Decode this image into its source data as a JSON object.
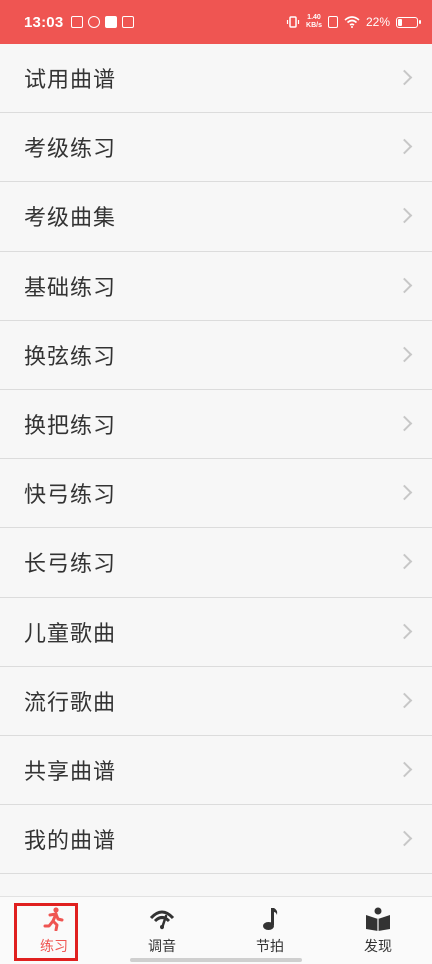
{
  "status_bar": {
    "time": "13:03",
    "net_speed_value": "1.40",
    "net_speed_unit": "KB/s",
    "battery_percent": "22%",
    "battery_level": 0.22,
    "accent_color": "#ef5552"
  },
  "list": {
    "items": [
      {
        "label": "试用曲谱"
      },
      {
        "label": "考级练习"
      },
      {
        "label": "考级曲集"
      },
      {
        "label": "基础练习"
      },
      {
        "label": "换弦练习"
      },
      {
        "label": "换把练习"
      },
      {
        "label": "快弓练习"
      },
      {
        "label": "长弓练习"
      },
      {
        "label": "儿童歌曲"
      },
      {
        "label": "流行歌曲"
      },
      {
        "label": "共享曲谱"
      },
      {
        "label": "我的曲谱"
      }
    ]
  },
  "tabbar": {
    "tabs": [
      {
        "label": "练习",
        "icon": "running-person-icon",
        "active": true
      },
      {
        "label": "调音",
        "icon": "tuner-gauge-icon",
        "active": false
      },
      {
        "label": "节拍",
        "icon": "music-note-icon",
        "active": false
      },
      {
        "label": "发现",
        "icon": "reading-person-icon",
        "active": false
      }
    ]
  }
}
